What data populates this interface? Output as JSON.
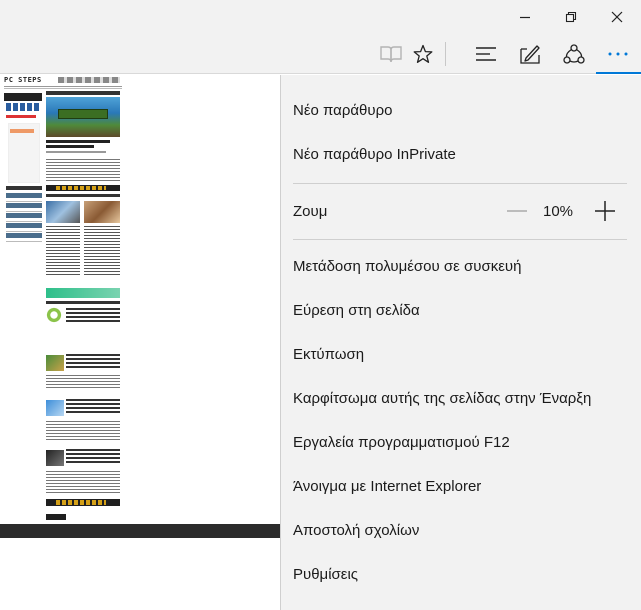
{
  "window": {
    "minimize_icon": "minimize-icon",
    "maximize_icon": "restore-icon",
    "close_icon": "close-icon"
  },
  "toolbar": {
    "icons": [
      "reading-view-icon",
      "favorite-star-icon",
      "hub-icon",
      "web-note-icon",
      "share-icon",
      "more-icon"
    ],
    "accent": "#0078d7"
  },
  "webpage": {
    "logo": "PC STEPS"
  },
  "menu": {
    "items": [
      {
        "label": "Νέο παράθυρο"
      },
      {
        "label": "Νέο παράθυρο InPrivate"
      },
      {
        "label": "Μετάδοση πολυμέσου σε συσκευή"
      },
      {
        "label": "Εύρεση στη σελίδα"
      },
      {
        "label": "Εκτύπωση"
      },
      {
        "label": "Καρφίτσωμα αυτής της σελίδας στην Έναρξη"
      },
      {
        "label": "Εργαλεία προγραμματισμού F12"
      },
      {
        "label": "Άνοιγμα με Internet Explorer"
      },
      {
        "label": "Αποστολή σχολίων"
      },
      {
        "label": "Ρυθμίσεις"
      }
    ],
    "zoom": {
      "label": "Ζουμ",
      "value": "10%",
      "minus_icon": "zoom-out-icon",
      "plus_icon": "zoom-in-icon"
    }
  }
}
